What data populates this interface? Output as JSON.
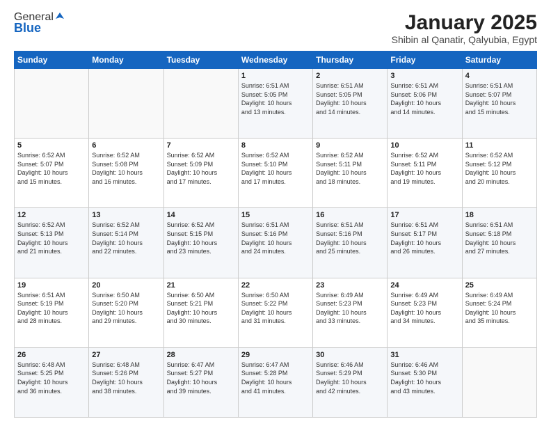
{
  "logo": {
    "general": "General",
    "blue": "Blue"
  },
  "header": {
    "month": "January 2025",
    "location": "Shibin al Qanatir, Qalyubia, Egypt"
  },
  "weekdays": [
    "Sunday",
    "Monday",
    "Tuesday",
    "Wednesday",
    "Thursday",
    "Friday",
    "Saturday"
  ],
  "weeks": [
    [
      {
        "day": "",
        "info": ""
      },
      {
        "day": "",
        "info": ""
      },
      {
        "day": "",
        "info": ""
      },
      {
        "day": "1",
        "info": "Sunrise: 6:51 AM\nSunset: 5:05 PM\nDaylight: 10 hours\nand 13 minutes."
      },
      {
        "day": "2",
        "info": "Sunrise: 6:51 AM\nSunset: 5:05 PM\nDaylight: 10 hours\nand 14 minutes."
      },
      {
        "day": "3",
        "info": "Sunrise: 6:51 AM\nSunset: 5:06 PM\nDaylight: 10 hours\nand 14 minutes."
      },
      {
        "day": "4",
        "info": "Sunrise: 6:51 AM\nSunset: 5:07 PM\nDaylight: 10 hours\nand 15 minutes."
      }
    ],
    [
      {
        "day": "5",
        "info": "Sunrise: 6:52 AM\nSunset: 5:07 PM\nDaylight: 10 hours\nand 15 minutes."
      },
      {
        "day": "6",
        "info": "Sunrise: 6:52 AM\nSunset: 5:08 PM\nDaylight: 10 hours\nand 16 minutes."
      },
      {
        "day": "7",
        "info": "Sunrise: 6:52 AM\nSunset: 5:09 PM\nDaylight: 10 hours\nand 17 minutes."
      },
      {
        "day": "8",
        "info": "Sunrise: 6:52 AM\nSunset: 5:10 PM\nDaylight: 10 hours\nand 17 minutes."
      },
      {
        "day": "9",
        "info": "Sunrise: 6:52 AM\nSunset: 5:11 PM\nDaylight: 10 hours\nand 18 minutes."
      },
      {
        "day": "10",
        "info": "Sunrise: 6:52 AM\nSunset: 5:11 PM\nDaylight: 10 hours\nand 19 minutes."
      },
      {
        "day": "11",
        "info": "Sunrise: 6:52 AM\nSunset: 5:12 PM\nDaylight: 10 hours\nand 20 minutes."
      }
    ],
    [
      {
        "day": "12",
        "info": "Sunrise: 6:52 AM\nSunset: 5:13 PM\nDaylight: 10 hours\nand 21 minutes."
      },
      {
        "day": "13",
        "info": "Sunrise: 6:52 AM\nSunset: 5:14 PM\nDaylight: 10 hours\nand 22 minutes."
      },
      {
        "day": "14",
        "info": "Sunrise: 6:52 AM\nSunset: 5:15 PM\nDaylight: 10 hours\nand 23 minutes."
      },
      {
        "day": "15",
        "info": "Sunrise: 6:51 AM\nSunset: 5:16 PM\nDaylight: 10 hours\nand 24 minutes."
      },
      {
        "day": "16",
        "info": "Sunrise: 6:51 AM\nSunset: 5:16 PM\nDaylight: 10 hours\nand 25 minutes."
      },
      {
        "day": "17",
        "info": "Sunrise: 6:51 AM\nSunset: 5:17 PM\nDaylight: 10 hours\nand 26 minutes."
      },
      {
        "day": "18",
        "info": "Sunrise: 6:51 AM\nSunset: 5:18 PM\nDaylight: 10 hours\nand 27 minutes."
      }
    ],
    [
      {
        "day": "19",
        "info": "Sunrise: 6:51 AM\nSunset: 5:19 PM\nDaylight: 10 hours\nand 28 minutes."
      },
      {
        "day": "20",
        "info": "Sunrise: 6:50 AM\nSunset: 5:20 PM\nDaylight: 10 hours\nand 29 minutes."
      },
      {
        "day": "21",
        "info": "Sunrise: 6:50 AM\nSunset: 5:21 PM\nDaylight: 10 hours\nand 30 minutes."
      },
      {
        "day": "22",
        "info": "Sunrise: 6:50 AM\nSunset: 5:22 PM\nDaylight: 10 hours\nand 31 minutes."
      },
      {
        "day": "23",
        "info": "Sunrise: 6:49 AM\nSunset: 5:23 PM\nDaylight: 10 hours\nand 33 minutes."
      },
      {
        "day": "24",
        "info": "Sunrise: 6:49 AM\nSunset: 5:23 PM\nDaylight: 10 hours\nand 34 minutes."
      },
      {
        "day": "25",
        "info": "Sunrise: 6:49 AM\nSunset: 5:24 PM\nDaylight: 10 hours\nand 35 minutes."
      }
    ],
    [
      {
        "day": "26",
        "info": "Sunrise: 6:48 AM\nSunset: 5:25 PM\nDaylight: 10 hours\nand 36 minutes."
      },
      {
        "day": "27",
        "info": "Sunrise: 6:48 AM\nSunset: 5:26 PM\nDaylight: 10 hours\nand 38 minutes."
      },
      {
        "day": "28",
        "info": "Sunrise: 6:47 AM\nSunset: 5:27 PM\nDaylight: 10 hours\nand 39 minutes."
      },
      {
        "day": "29",
        "info": "Sunrise: 6:47 AM\nSunset: 5:28 PM\nDaylight: 10 hours\nand 41 minutes."
      },
      {
        "day": "30",
        "info": "Sunrise: 6:46 AM\nSunset: 5:29 PM\nDaylight: 10 hours\nand 42 minutes."
      },
      {
        "day": "31",
        "info": "Sunrise: 6:46 AM\nSunset: 5:30 PM\nDaylight: 10 hours\nand 43 minutes."
      },
      {
        "day": "",
        "info": ""
      }
    ]
  ]
}
